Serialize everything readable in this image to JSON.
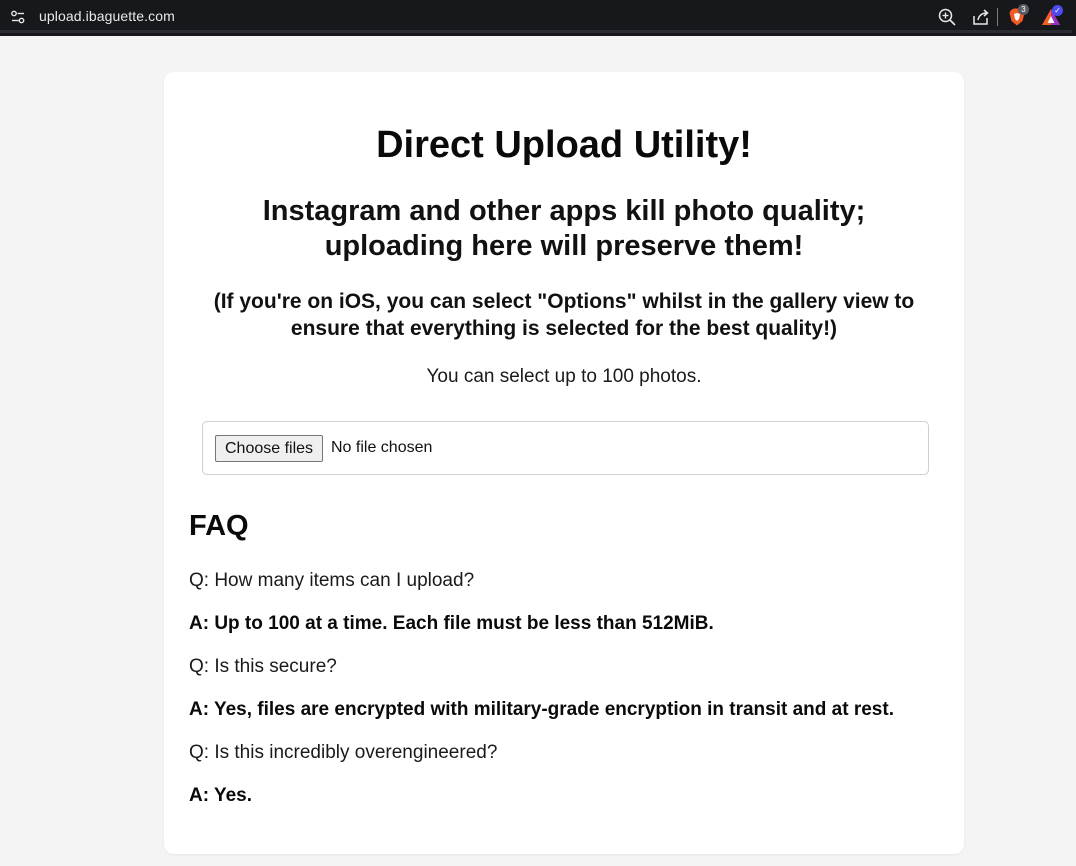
{
  "browser": {
    "url": "upload.ibaguette.com",
    "brave_badge": "3",
    "icons": [
      "site-settings-icon",
      "zoom-icon",
      "share-icon",
      "brave-shields-icon",
      "brave-rewards-icon"
    ]
  },
  "page": {
    "title": "Direct Upload Utility!",
    "subtitle": "Instagram and other apps kill photo quality; uploading here will preserve them!",
    "ios_note": "(If you're on iOS, you can select \"Options\" whilst in the gallery view to ensure that everything is selected for the best quality!)",
    "limit_note": "You can select up to 100 photos.",
    "file_input": {
      "button_label": "Choose files",
      "status": "No file chosen"
    }
  },
  "faq": {
    "title": "FAQ",
    "items": [
      {
        "q": "Q: How many items can I upload?",
        "a": "A: Up to 100 at a time. Each file must be less than 512MiB."
      },
      {
        "q": "Q: Is this secure?",
        "a": "A: Yes, files are encrypted with military-grade encryption in transit and at rest."
      },
      {
        "q": "Q: Is this incredibly overengineered?",
        "a": "A: Yes."
      }
    ]
  },
  "colors": {
    "page_bg": "#f4f4f4",
    "card_bg": "#ffffff",
    "browser_bar": "#16181c",
    "brave_orange": "#f25b22",
    "rewards_blue": "#4b4cf0"
  }
}
